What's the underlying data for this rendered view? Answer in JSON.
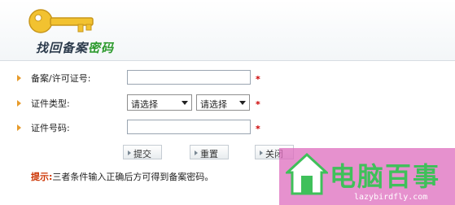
{
  "header": {
    "title_main": "找回备案",
    "title_accent": "密码"
  },
  "form": {
    "license_label": "备案/许可证号:",
    "cert_type_label": "证件类型:",
    "cert_type_select1": "请选择",
    "cert_type_select2": "请选择",
    "cert_no_label": "证件号码:",
    "required_mark": "*"
  },
  "buttons": {
    "submit": "提交",
    "reset": "重置",
    "close": "关闭"
  },
  "tip": {
    "label": "提示:",
    "text": "三者条件输入正确后方可得到备案密码。"
  },
  "watermark": {
    "text": "电脑百事",
    "url": "lazybirdfly.com"
  },
  "colors": {
    "accent_green": "#2d9a2d",
    "required_red": "#cc0000",
    "bullet_orange": "#e79b2b"
  }
}
